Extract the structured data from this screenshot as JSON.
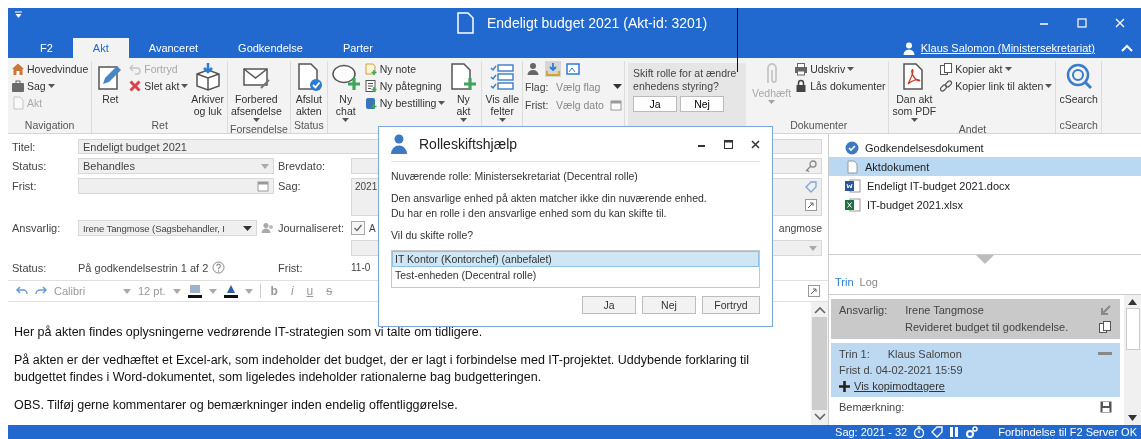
{
  "window": {
    "title": "Endeligt budget 2021 (Akt-id: 3201)"
  },
  "ribbon_tabs": [
    {
      "label": "F2",
      "selected": false
    },
    {
      "label": "Akt",
      "selected": true
    },
    {
      "label": "Avanceret",
      "selected": false
    },
    {
      "label": "Godkendelse",
      "selected": false
    },
    {
      "label": "Parter",
      "selected": false
    }
  ],
  "user": {
    "name": "Klaus Salomon (Ministersekretariat)"
  },
  "ribbon_groups": [
    {
      "kind": "group",
      "label": "Navigation",
      "columns": [
        [
          {
            "kind": "small",
            "label": "Hovedvindue",
            "dropdown": false,
            "disabled": false
          },
          {
            "kind": "small",
            "label": "Sag",
            "dropdown": true,
            "disabled": false
          },
          {
            "kind": "small",
            "label": "Akt",
            "dropdown": false,
            "disabled": true
          }
        ]
      ]
    },
    {
      "kind": "group",
      "label": "Ret",
      "columns": [
        [
          {
            "kind": "large",
            "label": "Ret",
            "dropdown": false,
            "disabled": false
          }
        ],
        [
          {
            "kind": "small",
            "label": "Fortryd",
            "dropdown": false,
            "disabled": true
          },
          {
            "kind": "small",
            "label": "Slet akt",
            "dropdown": true,
            "disabled": false
          }
        ],
        [
          {
            "kind": "large",
            "label": "Arkiver\nog luk",
            "dropdown": false,
            "disabled": false
          }
        ]
      ]
    },
    {
      "kind": "group",
      "label": "Forsendelse",
      "columns": [
        [
          {
            "kind": "large",
            "label": "Forbered\nafsendelse",
            "dropdown": true,
            "disabled": false
          }
        ]
      ]
    },
    {
      "kind": "group",
      "label": "Status",
      "columns": [
        [
          {
            "kind": "large",
            "label": "Afslut\nakten",
            "dropdown": false,
            "disabled": false
          }
        ]
      ]
    },
    {
      "kind": "group",
      "columns": [
        [
          {
            "kind": "large",
            "label": "Ny\nchat",
            "dropdown": true,
            "disabled": false
          }
        ],
        [
          {
            "kind": "small",
            "label": "Ny note",
            "dropdown": false,
            "disabled": false
          },
          {
            "kind": "small",
            "label": "Ny påtegning",
            "dropdown": false,
            "disabled": false
          },
          {
            "kind": "small",
            "label": "Ny bestilling",
            "dropdown": true,
            "disabled": false
          }
        ],
        [
          {
            "kind": "large",
            "label": "Ny\nakt",
            "dropdown": true,
            "disabled": false
          }
        ]
      ]
    },
    {
      "kind": "group",
      "columns": [
        [
          {
            "kind": "large",
            "label": "Vis alle\nfelter",
            "dropdown": true,
            "disabled": false
          }
        ]
      ]
    },
    {
      "kind": "group",
      "columns": [
        [
          {
            "kind": "iconrow",
            "buttons": [
              {
                "selected": false
              },
              {
                "selected": true
              },
              {
                "selected": false
              }
            ]
          },
          {
            "kind": "combo",
            "label": "Flag:",
            "placeholder": "Vælg flag"
          },
          {
            "kind": "date",
            "label": "Frist:",
            "placeholder": "Vælg dato"
          }
        ]
      ]
    },
    {
      "kind": "prompt",
      "text": "Skift rolle for at ændre enhedens styring?",
      "buttons": [
        "Ja",
        "Nej"
      ]
    },
    {
      "kind": "group",
      "label": "Dokumenter",
      "columns": [
        [
          {
            "kind": "large",
            "label": "Vedhæft",
            "dropdown": true,
            "disabled": true
          }
        ],
        [
          {
            "kind": "small",
            "label": "Udskriv",
            "dropdown": true,
            "disabled": false
          },
          {
            "kind": "small",
            "label": "Lås dokumenter",
            "dropdown": false,
            "disabled": false
          }
        ]
      ]
    },
    {
      "kind": "group",
      "label": "Andet",
      "columns": [
        [
          {
            "kind": "large",
            "label": "Dan akt\nsom PDF",
            "dropdown": true,
            "disabled": false
          }
        ],
        [
          {
            "kind": "small",
            "label": "Kopier akt",
            "dropdown": true,
            "disabled": false
          },
          {
            "kind": "small",
            "label": "Kopier link til akten",
            "dropdown": true,
            "disabled": false
          }
        ]
      ]
    },
    {
      "kind": "group",
      "label": "cSearch",
      "columns": [
        [
          {
            "kind": "large",
            "label": "cSearch",
            "dropdown": false,
            "disabled": false
          }
        ]
      ]
    }
  ],
  "form": {
    "title": {
      "label": "Titel:",
      "value": "Endeligt budget 2021"
    },
    "status": {
      "label": "Status:",
      "value": "Behandles"
    },
    "letter_date": {
      "label": "Brevdato:"
    },
    "deadline": {
      "label": "Frist:"
    },
    "case": {
      "label": "Sag:",
      "value": "2021"
    },
    "responsible": {
      "label": "Ansvarlig:",
      "value": "Irene Tangmose (Sagsbehandler, I"
    },
    "journalized": {
      "label": "Journaliseret:",
      "checked": true,
      "text": "A"
    },
    "partial_text": "angmose",
    "approval_status": {
      "label": "Status:",
      "value": "På godkendelsestrin 1 af 2"
    },
    "approval_deadline": {
      "label": "Frist:",
      "value": "11-0"
    }
  },
  "editor": {
    "font": "Calibri",
    "size": "12 pt.",
    "format_buttons": [
      "b",
      "i",
      "u",
      "s"
    ],
    "paragraphs": [
      "Her på akten findes oplysningerne vedrørende IT-strategien som vi talte om tidligere.",
      "På akten er der vedhæftet et Excel-ark, som indeholder det budget, der er lagt i forbindelse med IT-projektet. Uddybende forklaring til budgettet findes i Word-dokumentet, som ligeledes indeholder rationalerne bag budgetteringen.",
      "OBS. Tilføj gerne kommentarer og bemærkninger inden endelig offentliggørelse."
    ]
  },
  "dialog": {
    "title": "Rolleskiftshjælp",
    "current_role": "Nuværende rolle: Ministersekretariat (Decentral rolle)",
    "message_lines": [
      "Den ansvarlige enhed på akten matcher ikke din nuværende enhed.",
      "Du har en rolle i den ansvarlige enhed som du kan skifte til."
    ],
    "question": "Vil du skifte rolle?",
    "options": [
      {
        "label": "IT Kontor (Kontorchef) (anbefalet)",
        "selected": true
      },
      {
        "label": "Test-enheden (Decentral rolle)",
        "selected": false
      }
    ],
    "buttons": [
      "Ja",
      "Nej",
      "Fortryd"
    ]
  },
  "documents": [
    {
      "name": "Godkendelsesdokument",
      "kind": "approval",
      "selected": false
    },
    {
      "name": "Aktdokument",
      "kind": "document",
      "selected": true
    },
    {
      "name": "Endeligt IT-budget 2021.docx",
      "kind": "word",
      "selected": false
    },
    {
      "name": "IT-budget 2021.xlsx",
      "kind": "excel",
      "selected": false
    }
  ],
  "panel_tabs": [
    {
      "label": "Trin",
      "selected": true
    },
    {
      "label": "Log",
      "selected": false
    }
  ],
  "steps": [
    {
      "kind": "owner",
      "label": "Ansvarlig:",
      "person": "Irene Tangmose",
      "note": "Revideret budget til godkendelse."
    },
    {
      "kind": "step",
      "label": "Trin 1:",
      "person": "Klaus Salomon",
      "deadline": "Frist d. 04-02-2021 15:59",
      "link": "Vis kopimodtagere",
      "expanded": true
    }
  ],
  "remark": {
    "label": "Bemærkning:"
  },
  "status_bar": {
    "case": "Sag: 2021 - 32",
    "connection": "Forbindelse til F2 Server OK"
  }
}
